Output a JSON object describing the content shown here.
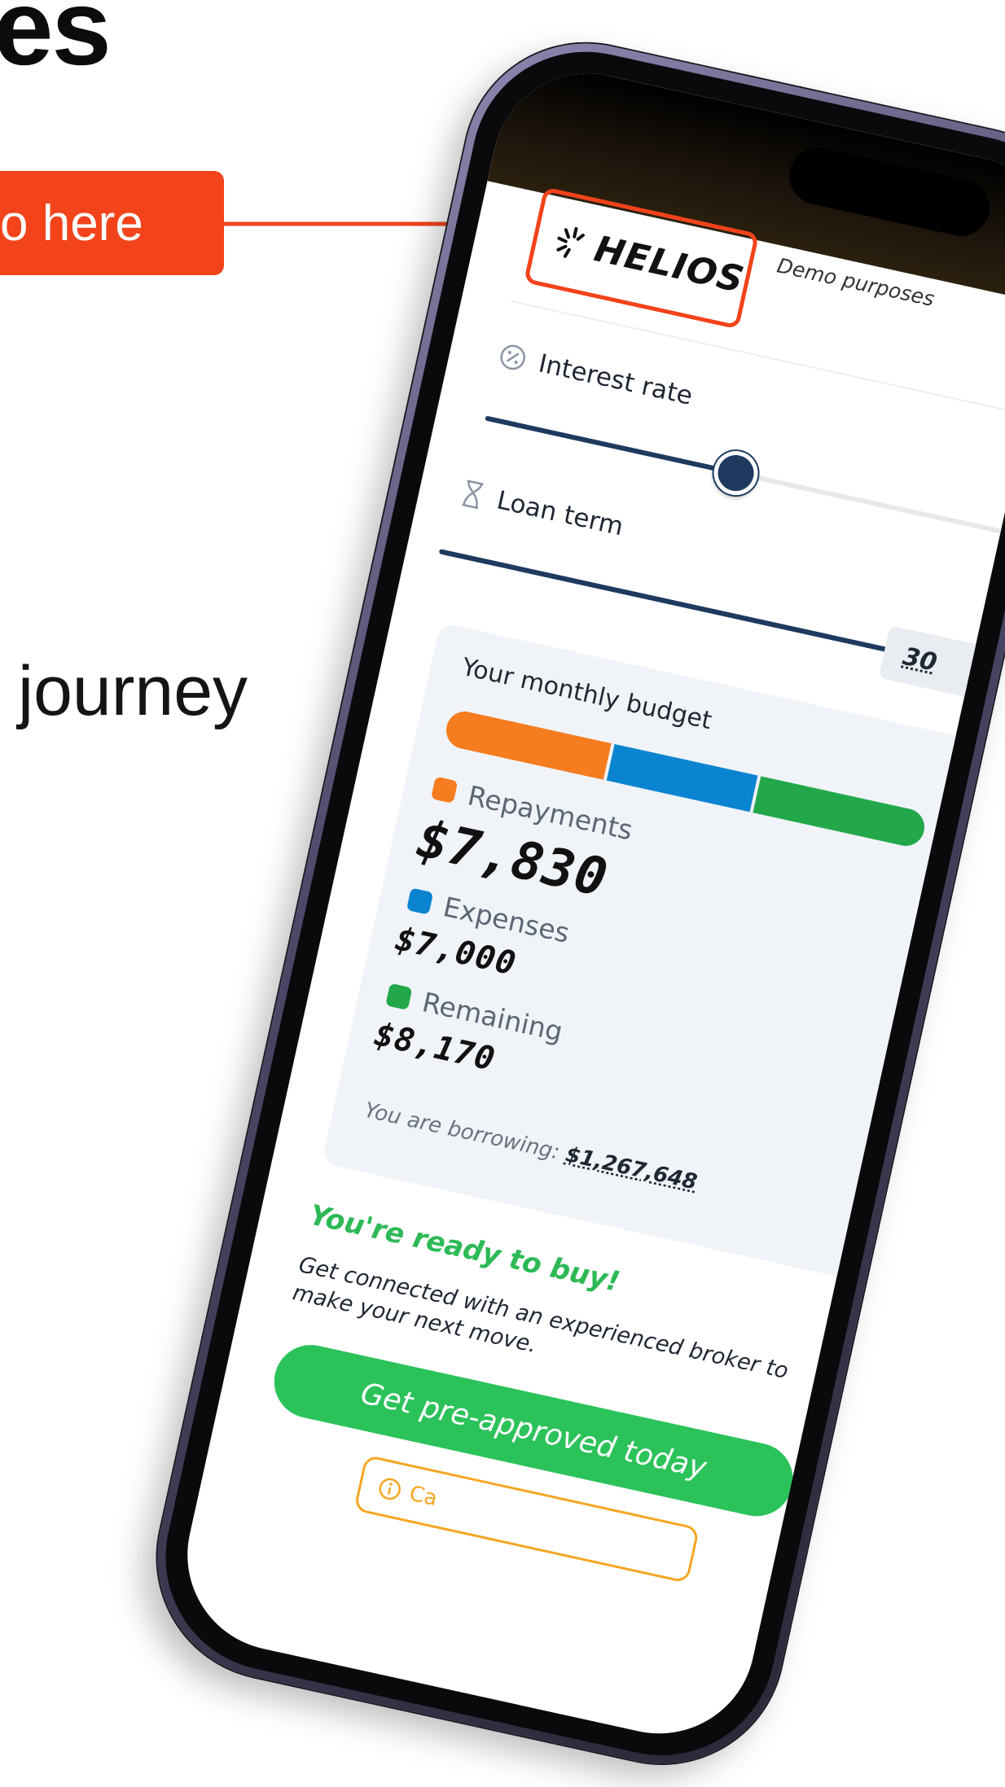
{
  "hero": {
    "title": "es",
    "callout": "o here",
    "journey": "journey"
  },
  "phone": {
    "demo_label": "Demo purposes",
    "logo_text": "HELIOS",
    "interest_rate_label": "Interest rate",
    "loan_term_label": "Loan term",
    "loan_term_value": "30",
    "interest_rate_level": 0.45,
    "loan_term_level": 1.0
  },
  "budget": {
    "title": "Your monthly budget",
    "items": [
      {
        "label": "Repayments",
        "amount": "$7,830",
        "color": "#f57c1f",
        "value": 7830
      },
      {
        "label": "Expenses",
        "amount": "$7,000",
        "color": "#0a84d0",
        "value": 7000
      },
      {
        "label": "Remaining",
        "amount": "$8,170",
        "color": "#22a84a",
        "value": 8170
      }
    ],
    "borrowing_label": "You are borrowing:",
    "borrowing_value": "$1,267,648"
  },
  "cta": {
    "ready_title": "You're ready to buy!",
    "ready_text": "Get connected with an experienced broker to make your next move.",
    "button_label": "Get pre-approved today",
    "secondary_label": "Ca"
  },
  "colors": {
    "accent": "#f2431b",
    "slider": "#1e3a5f",
    "success": "#2cc25a"
  }
}
